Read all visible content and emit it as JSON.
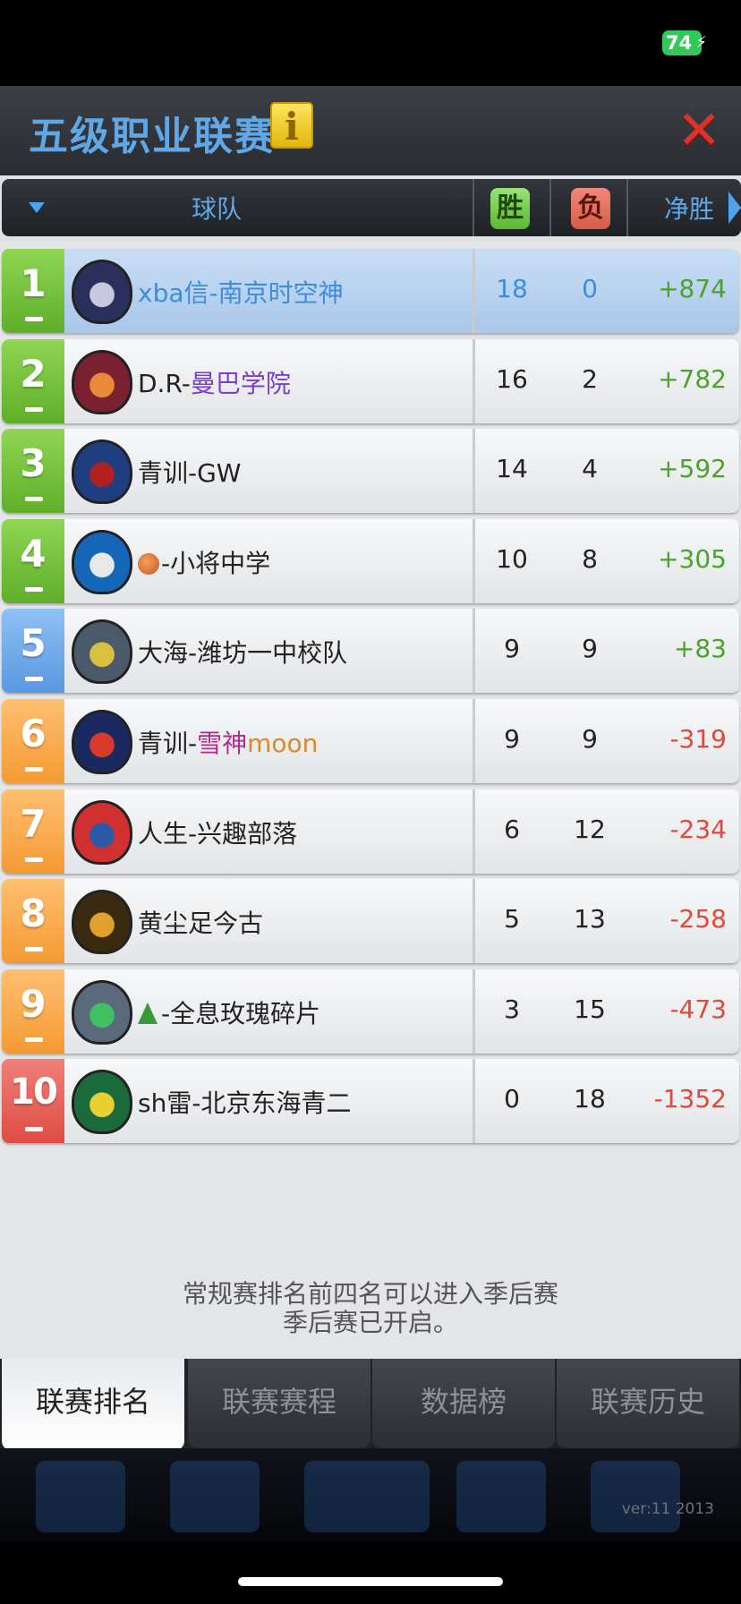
{
  "status": {
    "battery": "74"
  },
  "header": {
    "title": "五级职业联赛",
    "info_icon": "info-icon",
    "close_icon": "close-icon"
  },
  "columns": {
    "team": "球队",
    "win": "胜",
    "loss": "负",
    "net": "净胜"
  },
  "rows": [
    {
      "rank": "1",
      "name_parts": [
        {
          "t": "xba信-南京时空神",
          "c": "blue"
        }
      ],
      "win": "18",
      "loss": "0",
      "net": "+874",
      "color": "green",
      "highlight": true
    },
    {
      "rank": "2",
      "name_parts": [
        {
          "t": "D.R-",
          "c": ""
        },
        {
          "t": "曼巴学院",
          "c": "purple"
        }
      ],
      "win": "16",
      "loss": "2",
      "net": "+782",
      "color": "green"
    },
    {
      "rank": "3",
      "name_parts": [
        {
          "t": "青训-GW",
          "c": ""
        }
      ],
      "win": "14",
      "loss": "4",
      "net": "+592",
      "color": "green"
    },
    {
      "rank": "4",
      "name_parts": [
        {
          "t": "-小将中学",
          "c": ""
        }
      ],
      "emoji": "basketball",
      "win": "10",
      "loss": "8",
      "net": "+305",
      "color": "green"
    },
    {
      "rank": "5",
      "name_parts": [
        {
          "t": "大海-潍坊一中校队",
          "c": ""
        }
      ],
      "win": "9",
      "loss": "9",
      "net": "+83",
      "color": "blue"
    },
    {
      "rank": "6",
      "name_parts": [
        {
          "t": "青训-",
          "c": ""
        },
        {
          "t": "雪神",
          "c": "magenta"
        },
        {
          "t": "moon",
          "c": "orange"
        }
      ],
      "win": "9",
      "loss": "9",
      "net": "-319",
      "color": "orange"
    },
    {
      "rank": "7",
      "name_parts": [
        {
          "t": "人生-兴趣部落",
          "c": ""
        }
      ],
      "win": "6",
      "loss": "12",
      "net": "-234",
      "color": "orange"
    },
    {
      "rank": "8",
      "name_parts": [
        {
          "t": "黄尘足今古",
          "c": ""
        }
      ],
      "win": "5",
      "loss": "13",
      "net": "-258",
      "color": "orange"
    },
    {
      "rank": "9",
      "name_parts": [
        {
          "t": "-全息玫瑰碎片",
          "c": ""
        }
      ],
      "emoji": "tree",
      "win": "3",
      "loss": "15",
      "net": "-473",
      "color": "orange"
    },
    {
      "rank": "10",
      "name_parts": [
        {
          "t": "sh雷-北京东海青二",
          "c": ""
        }
      ],
      "win": "0",
      "loss": "18",
      "net": "-1352",
      "color": "red"
    }
  ],
  "note": {
    "line1": "常规赛排名前四名可以进入季后赛",
    "line2": "季后赛已开启。"
  },
  "tabs": [
    {
      "label": "联赛排名",
      "active": true
    },
    {
      "label": "联赛赛程",
      "active": false
    },
    {
      "label": "数据榜",
      "active": false
    },
    {
      "label": "联赛历史",
      "active": false
    }
  ],
  "version": "ver:11  2013"
}
